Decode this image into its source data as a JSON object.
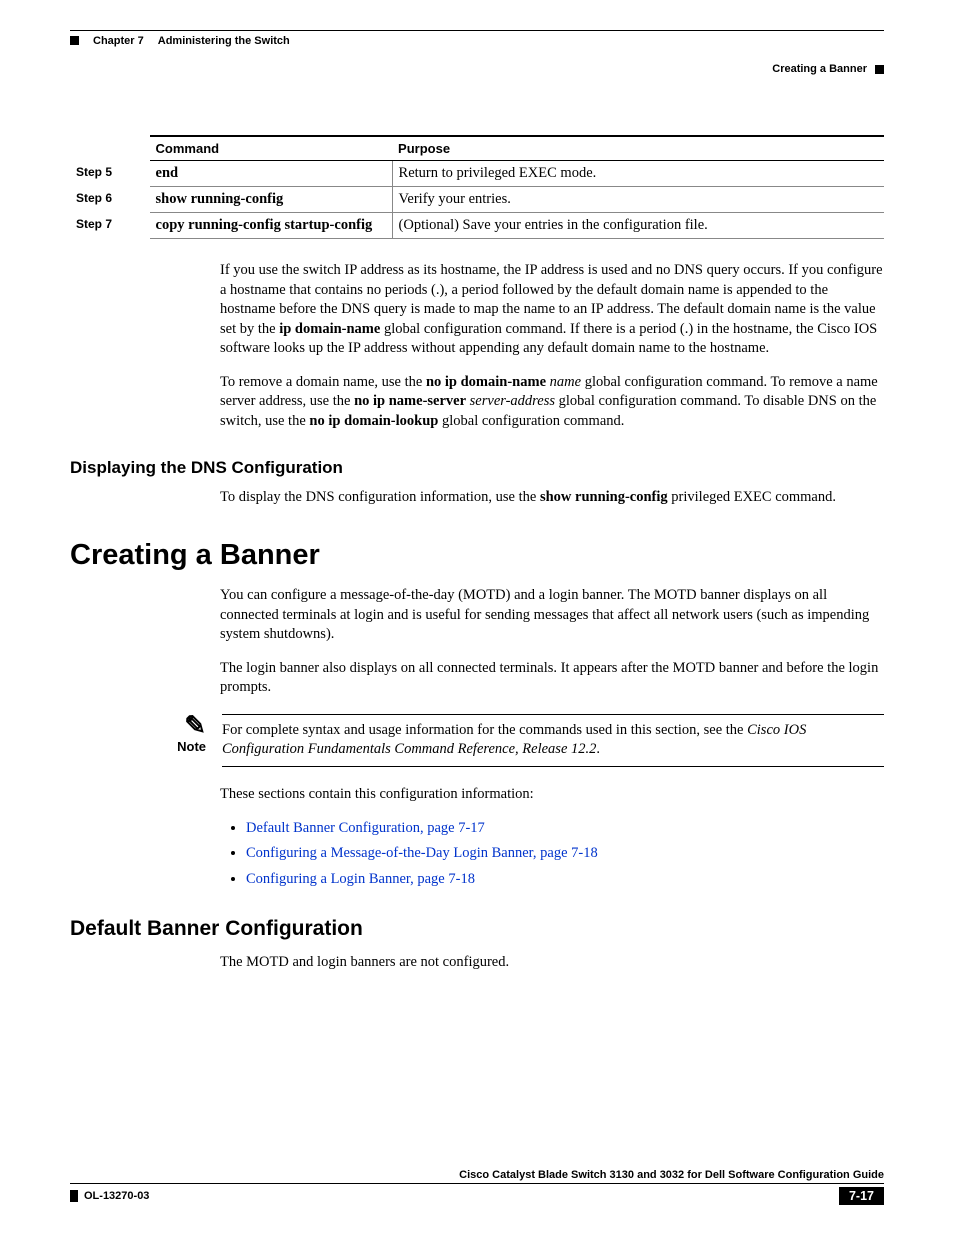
{
  "header": {
    "chapter_label": "Chapter 7",
    "chapter_title": "Administering the Switch",
    "right_label": "Creating a Banner"
  },
  "table": {
    "head_command": "Command",
    "head_purpose": "Purpose",
    "rows": [
      {
        "step": "Step 5",
        "command": "end",
        "purpose": "Return to privileged EXEC mode."
      },
      {
        "step": "Step 6",
        "command": "show running-config",
        "purpose": "Verify your entries."
      },
      {
        "step": "Step 7",
        "command": "copy running-config startup-config",
        "purpose": "(Optional) Save your entries in the configuration file."
      }
    ]
  },
  "para1": {
    "a": "If you use the switch IP address as its hostname, the IP address is used and no DNS query occurs. If you configure a hostname that contains no periods (.), a period followed by the default domain name is appended to the hostname before the DNS query is made to map the name to an IP address. The default domain name is the value set by the ",
    "b": "ip domain-name",
    "c": " global configuration command. If there is a period (.) in the hostname, the Cisco IOS software looks up the IP address without appending any default domain name to the hostname."
  },
  "para2": {
    "a": "To remove a domain name, use the ",
    "b": "no ip domain-name",
    "c": " ",
    "d": "name",
    "e": " global configuration command. To remove a name server address, use the ",
    "f": "no ip name-server",
    "g": " ",
    "h": "server-address",
    "i": " global configuration command. To disable DNS on the switch, use the ",
    "j": "no ip domain-lookup",
    "k": " global configuration command."
  },
  "sec_dns": {
    "title": "Displaying the DNS Configuration",
    "a": "To display the DNS configuration information, use the ",
    "b": "show running-config",
    "c": " privileged EXEC command."
  },
  "sec_banner": {
    "title": "Creating a Banner",
    "p1": "You can configure a message-of-the-day (MOTD) and a login banner. The MOTD banner displays on all connected terminals at login and is useful for sending messages that affect all network users (such as impending system shutdowns).",
    "p2": "The login banner also displays on all connected terminals. It appears after the MOTD banner and before the login prompts."
  },
  "note": {
    "label": "Note",
    "a": "For complete syntax and usage information for the commands used in this section, see the ",
    "b": "Cisco IOS Configuration Fundamentals Command Reference, Release 12.2",
    "c": "."
  },
  "links_intro": "These sections contain this configuration information:",
  "links": [
    "Default Banner Configuration, page 7-17",
    "Configuring a Message-of-the-Day Login Banner, page 7-18",
    "Configuring a Login Banner, page 7-18"
  ],
  "sec_default": {
    "title": "Default Banner Configuration",
    "p": "The MOTD and login banners are not configured."
  },
  "footer": {
    "title": "Cisco Catalyst Blade Switch 3130 and 3032 for Dell Software Configuration Guide",
    "docid": "OL-13270-03",
    "page": "7-17"
  }
}
